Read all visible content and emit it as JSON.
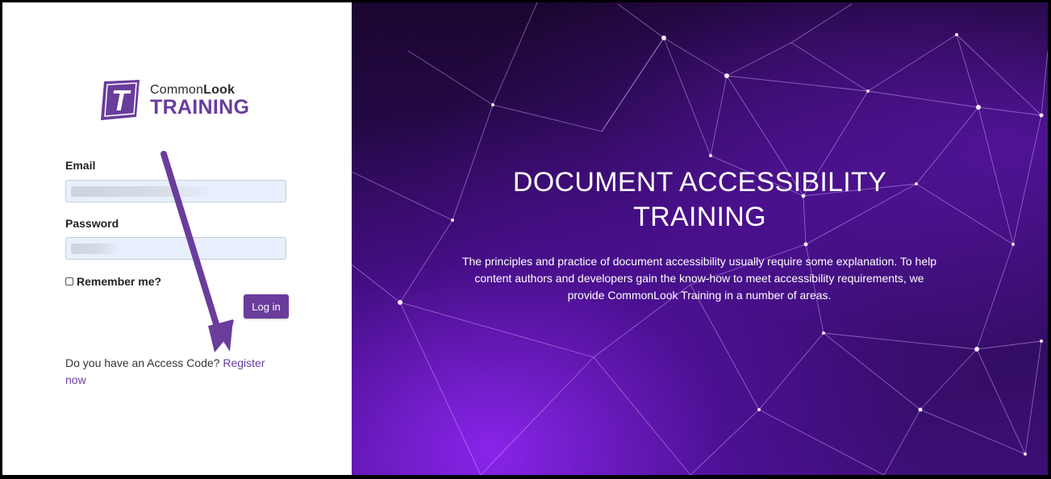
{
  "brand": {
    "name_part1": "Common",
    "name_part2": "Look",
    "product": "TRAINING",
    "logo_letter": "T",
    "accent_color": "#6a3c9c"
  },
  "login_form": {
    "email_label": "Email",
    "email_value": "",
    "password_label": "Password",
    "password_value": "",
    "remember_label": "Remember me?",
    "remember_checked": false,
    "login_button": "Log in"
  },
  "register": {
    "prompt": "Do you have an Access Code?",
    "link": "Register now"
  },
  "hero": {
    "title": "DOCUMENT ACCESSIBILITY TRAINING",
    "description": "The principles and practice of document accessibility usually require some explanation. To help content authors and developers gain the know-how to meet accessibility requirements, we provide CommonLook Training in a number of areas."
  },
  "icons": [
    "logo-t-icon",
    "checkbox-icon",
    "annotation-arrow-icon"
  ]
}
